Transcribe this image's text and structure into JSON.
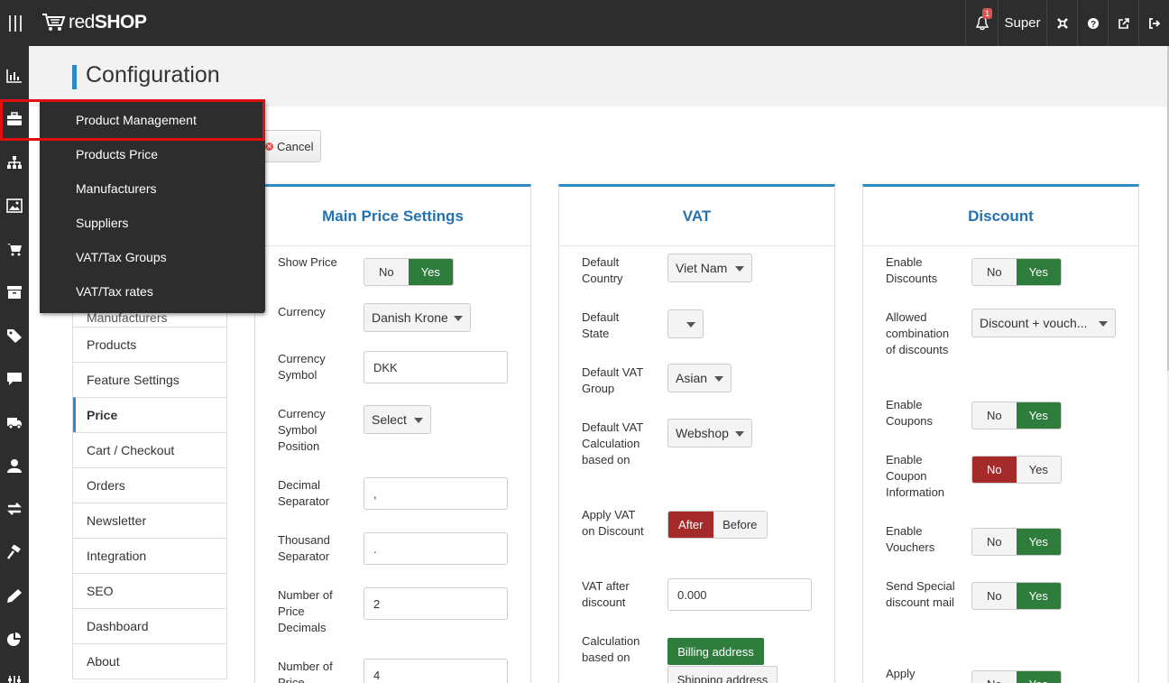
{
  "topbar": {
    "logo": "redSHOP",
    "logo_bold": "red",
    "logo_light": "SHOP",
    "notifications_count": "1",
    "user": "Super",
    "icons": [
      "bell-icon",
      "joomla-icon",
      "help-icon",
      "external-link-icon",
      "logout-icon"
    ]
  },
  "sidebar_icons": [
    "bar-chart-icon",
    "briefcase-icon",
    "sitemap-icon",
    "image-icon",
    "cart-icon",
    "archive-icon",
    "tag-icon",
    "comment-icon",
    "truck-icon",
    "user-icon",
    "exchange-icon",
    "gavel-icon",
    "pencil-icon",
    "pie-chart-icon",
    "sliders-icon"
  ],
  "page": {
    "title": "Configuration"
  },
  "toolbar": {
    "cancel": "Cancel"
  },
  "flyout": {
    "items": [
      "Product Management",
      "Products Price",
      "Manufacturers",
      "Suppliers",
      "VAT/Tax Groups",
      "VAT/Tax rates"
    ],
    "highlighted": "Product Management"
  },
  "config_nav": {
    "hidden_item": "Manufacturers",
    "items": [
      "Products",
      "Feature Settings",
      "Price",
      "Cart / Checkout",
      "Orders",
      "Newsletter",
      "Integration",
      "SEO",
      "Dashboard",
      "About"
    ],
    "active": "Price"
  },
  "main_price": {
    "title": "Main Price Settings",
    "show_price": {
      "label": "Show Price",
      "no": "No",
      "yes": "Yes",
      "value": "Yes"
    },
    "currency": {
      "label": "Currency",
      "value": "Danish Krone"
    },
    "currency_symbol": {
      "label": "Currency Symbol",
      "value": "DKK"
    },
    "currency_symbol_position": {
      "label": "Currency Symbol Position",
      "value": "Select"
    },
    "decimal_separator": {
      "label": "Decimal Separator",
      "value": ","
    },
    "thousand_separator": {
      "label": "Thousand Separator",
      "value": "."
    },
    "price_decimals": {
      "label": "Number of Price Decimals",
      "value": "2"
    },
    "price_decimals_2": {
      "label": "Number of Price",
      "value": "4"
    }
  },
  "vat": {
    "title": "VAT",
    "default_country": {
      "label": "Default Country",
      "value": "Viet Nam"
    },
    "default_state": {
      "label": "Default State",
      "value": ""
    },
    "default_vat_group": {
      "label": "Default VAT Group",
      "value": "Asian"
    },
    "vat_calc_based_on": {
      "label": "Default VAT Calculation based on",
      "value": "Webshop"
    },
    "apply_vat_on_discount": {
      "label": "Apply VAT on Discount",
      "after": "After",
      "before": "Before",
      "value": "After"
    },
    "vat_after_discount": {
      "label": "VAT after discount",
      "value": "0.000"
    },
    "calculation_based_on": {
      "label": "Calculation based on",
      "billing": "Billing address",
      "shipping": "Shipping address",
      "value": "Billing address"
    }
  },
  "discount": {
    "title": "Discount",
    "enable_discounts": {
      "label": "Enable Discounts",
      "no": "No",
      "yes": "Yes",
      "value": "Yes"
    },
    "allowed_combination": {
      "label": "Allowed combination of discounts",
      "value": "Discount + vouch..."
    },
    "enable_coupons": {
      "label": "Enable Coupons",
      "no": "No",
      "yes": "Yes",
      "value": "Yes"
    },
    "enable_coupon_info": {
      "label": "Enable Coupon Information",
      "no": "No",
      "yes": "Yes",
      "value": "No"
    },
    "enable_vouchers": {
      "label": "Enable Vouchers",
      "no": "No",
      "yes": "Yes",
      "value": "Yes"
    },
    "send_special_discount_mail": {
      "label": "Send Special discount mail",
      "no": "No",
      "yes": "Yes",
      "value": "Yes"
    },
    "apply": {
      "label": "Apply",
      "no": "No",
      "yes": "Yes",
      "value": "Yes"
    }
  }
}
